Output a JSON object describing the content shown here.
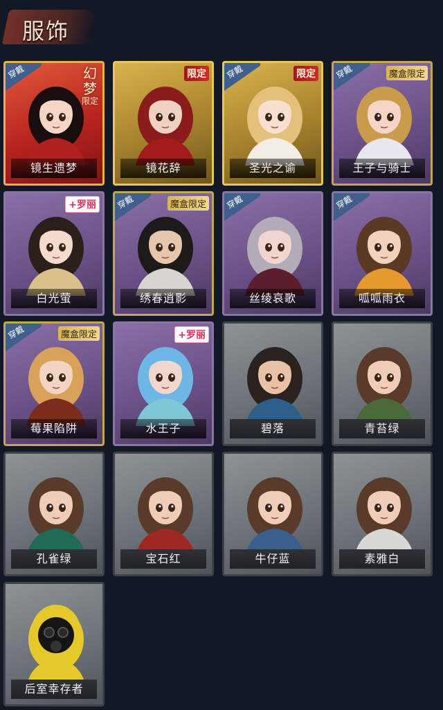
{
  "header": {
    "title": "服饰"
  },
  "badges": {
    "wearing": "穿戴"
  },
  "costumes": [
    {
      "name": "镜生遗梦",
      "rarity": "red",
      "wearing": true,
      "tag": "幻梦",
      "tag_small": "限定",
      "tag_type": "dream",
      "accent": "#c8312a",
      "hair": "#1a0d0d",
      "skin": "#f3d6c6",
      "outfit": "#b02020"
    },
    {
      "name": "镜花辞",
      "rarity": "gold",
      "wearing": false,
      "tag": "限定",
      "tag_type": "limited",
      "accent": "#b8932f",
      "hair": "#8a1c1c",
      "skin": "#f0d2c0",
      "outfit": "#a11b1b"
    },
    {
      "name": "圣光之谕",
      "rarity": "gold",
      "wearing": true,
      "tag": "限定",
      "tag_type": "limited",
      "accent": "#b8932f",
      "hair": "#e2c27a",
      "skin": "#f7e0cf",
      "outfit": "#f2eee6"
    },
    {
      "name": "王子与骑士",
      "rarity": "purple",
      "wearing": true,
      "tag": "魔盒限定",
      "tag_type": "box",
      "accent": "#7a5f98",
      "hair": "#c99c4c",
      "skin": "#f3d6c6",
      "outfit": "#e8e6ee"
    },
    {
      "name": "白光萤",
      "rarity": "purple2",
      "wearing": false,
      "tag": "+罗丽",
      "tag_type": "lolita",
      "accent": "#7a5f98",
      "hair": "#2b1f1a",
      "skin": "#f4dccd",
      "outfit": "#d9c28a"
    },
    {
      "name": "绣春逍影",
      "rarity": "purple",
      "wearing": true,
      "tag": "魔盒限定",
      "tag_type": "box",
      "accent": "#7a5f98",
      "hair": "#1d1a1a",
      "skin": "#e6c6ad",
      "outfit": "#d8d4d0"
    },
    {
      "name": "丝绫哀歌",
      "rarity": "purple2",
      "wearing": true,
      "tag": "",
      "tag_type": "none",
      "accent": "#7a5f98",
      "hair": "#b3acb8",
      "skin": "#f1d6cf",
      "outfit": "#5c1d2c"
    },
    {
      "name": "呱呱雨衣",
      "rarity": "purple2",
      "wearing": true,
      "tag": "",
      "tag_type": "none",
      "accent": "#7a5f98",
      "hair": "#5a3a24",
      "skin": "#f1d2bd",
      "outfit": "#e69a2e"
    },
    {
      "name": "莓果陷阱",
      "rarity": "purple",
      "wearing": true,
      "tag": "魔盒限定",
      "tag_type": "box",
      "accent": "#7a5f98",
      "hair": "#d8a25a",
      "skin": "#f2d4c2",
      "outfit": "#7d2b1c"
    },
    {
      "name": "水王子",
      "rarity": "purple2",
      "wearing": false,
      "tag": "+罗丽",
      "tag_type": "lolita",
      "accent": "#7a5f98",
      "hair": "#6db7e6",
      "skin": "#f0d6cc",
      "outfit": "#7fc6d6"
    },
    {
      "name": "碧落",
      "rarity": "grey",
      "wearing": false,
      "tag": "",
      "tag_type": "none",
      "accent": "#6d7378",
      "hair": "#2a221e",
      "skin": "#e7c2a6",
      "outfit": "#2c5f8a"
    },
    {
      "name": "青苔绿",
      "rarity": "grey",
      "wearing": false,
      "tag": "",
      "tag_type": "none",
      "accent": "#6d7378",
      "hair": "#5a3a28",
      "skin": "#efcdb6",
      "outfit": "#4a6a3a"
    },
    {
      "name": "孔雀绿",
      "rarity": "grey",
      "wearing": false,
      "tag": "",
      "tag_type": "none",
      "accent": "#6d7378",
      "hair": "#5a3a28",
      "skin": "#efcdb6",
      "outfit": "#1f6b55"
    },
    {
      "name": "宝石红",
      "rarity": "grey",
      "wearing": false,
      "tag": "",
      "tag_type": "none",
      "accent": "#6d7378",
      "hair": "#5a3a28",
      "skin": "#efcdb6",
      "outfit": "#9c2a22"
    },
    {
      "name": "牛仔蓝",
      "rarity": "grey",
      "wearing": false,
      "tag": "",
      "tag_type": "none",
      "accent": "#6d7378",
      "hair": "#5a3a28",
      "skin": "#efcdb6",
      "outfit": "#3a5e8e"
    },
    {
      "name": "素雅白",
      "rarity": "grey",
      "wearing": false,
      "tag": "",
      "tag_type": "none",
      "accent": "#6d7378",
      "hair": "#5a3a28",
      "skin": "#efcdb6",
      "outfit": "#d8d8d4"
    },
    {
      "name": "后室幸存者",
      "rarity": "grey",
      "wearing": false,
      "tag": "",
      "tag_type": "none",
      "accent": "#6d7378",
      "hair": "#e5c92a",
      "skin": "#1c1c1c",
      "outfit": "#e5c92a",
      "masked": true
    }
  ]
}
